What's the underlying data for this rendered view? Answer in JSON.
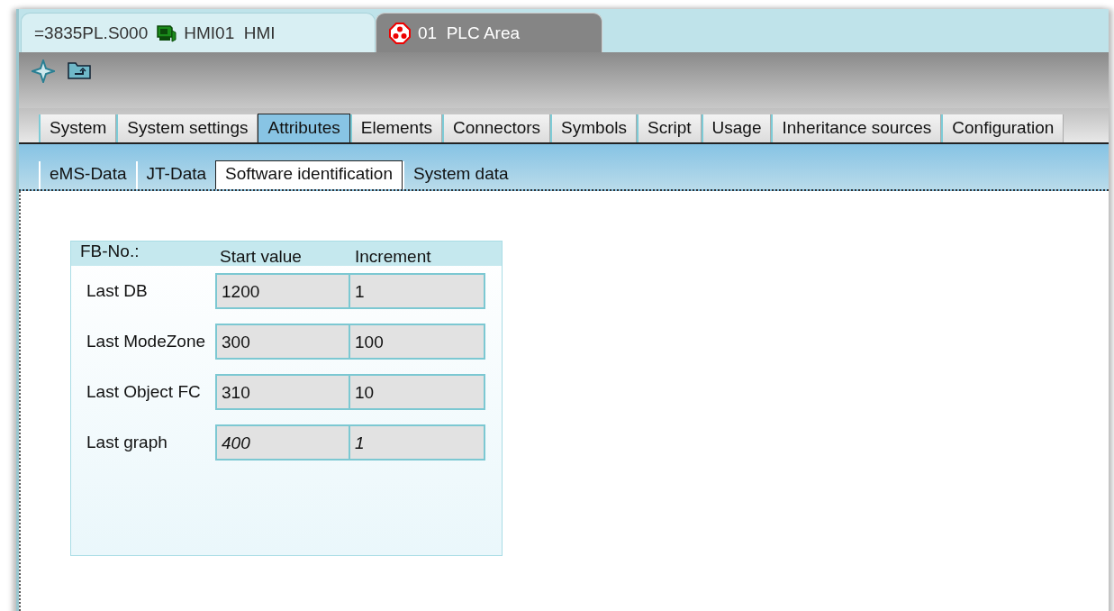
{
  "doc_tabs": [
    {
      "label": "=3835PL.S000",
      "icon_label": "HMI01  HMI",
      "kind": "hmi",
      "selected": false
    },
    {
      "icon_label": "01  PLC Area",
      "kind": "plc",
      "selected": true
    }
  ],
  "tabs": [
    {
      "label": "System",
      "selected": false
    },
    {
      "label": "System settings",
      "selected": false
    },
    {
      "label": "Attributes",
      "selected": true
    },
    {
      "label": "Elements",
      "selected": false
    },
    {
      "label": "Connectors",
      "selected": false
    },
    {
      "label": "Symbols",
      "selected": false
    },
    {
      "label": "Script",
      "selected": false
    },
    {
      "label": "Usage",
      "selected": false
    },
    {
      "label": "Inheritance sources",
      "selected": false
    },
    {
      "label": "Configuration",
      "selected": false
    }
  ],
  "subtabs": [
    {
      "label": "eMS-Data",
      "selected": false
    },
    {
      "label": "JT-Data",
      "selected": false
    },
    {
      "label": "Software identification",
      "selected": true
    },
    {
      "label": "System data",
      "selected": false
    }
  ],
  "panel": {
    "title": "FB-No.:",
    "columns": [
      "Start value",
      "Increment"
    ],
    "rows": [
      {
        "label": "Last DB",
        "start": "1200",
        "increment": "1",
        "inherited": false
      },
      {
        "label": "Last ModeZone",
        "start": "300",
        "increment": "100",
        "inherited": false
      },
      {
        "label": "Last Object FC",
        "start": "310",
        "increment": "10",
        "inherited": false
      },
      {
        "label": "Last graph",
        "start": "400",
        "increment": "1",
        "inherited": true
      }
    ]
  }
}
